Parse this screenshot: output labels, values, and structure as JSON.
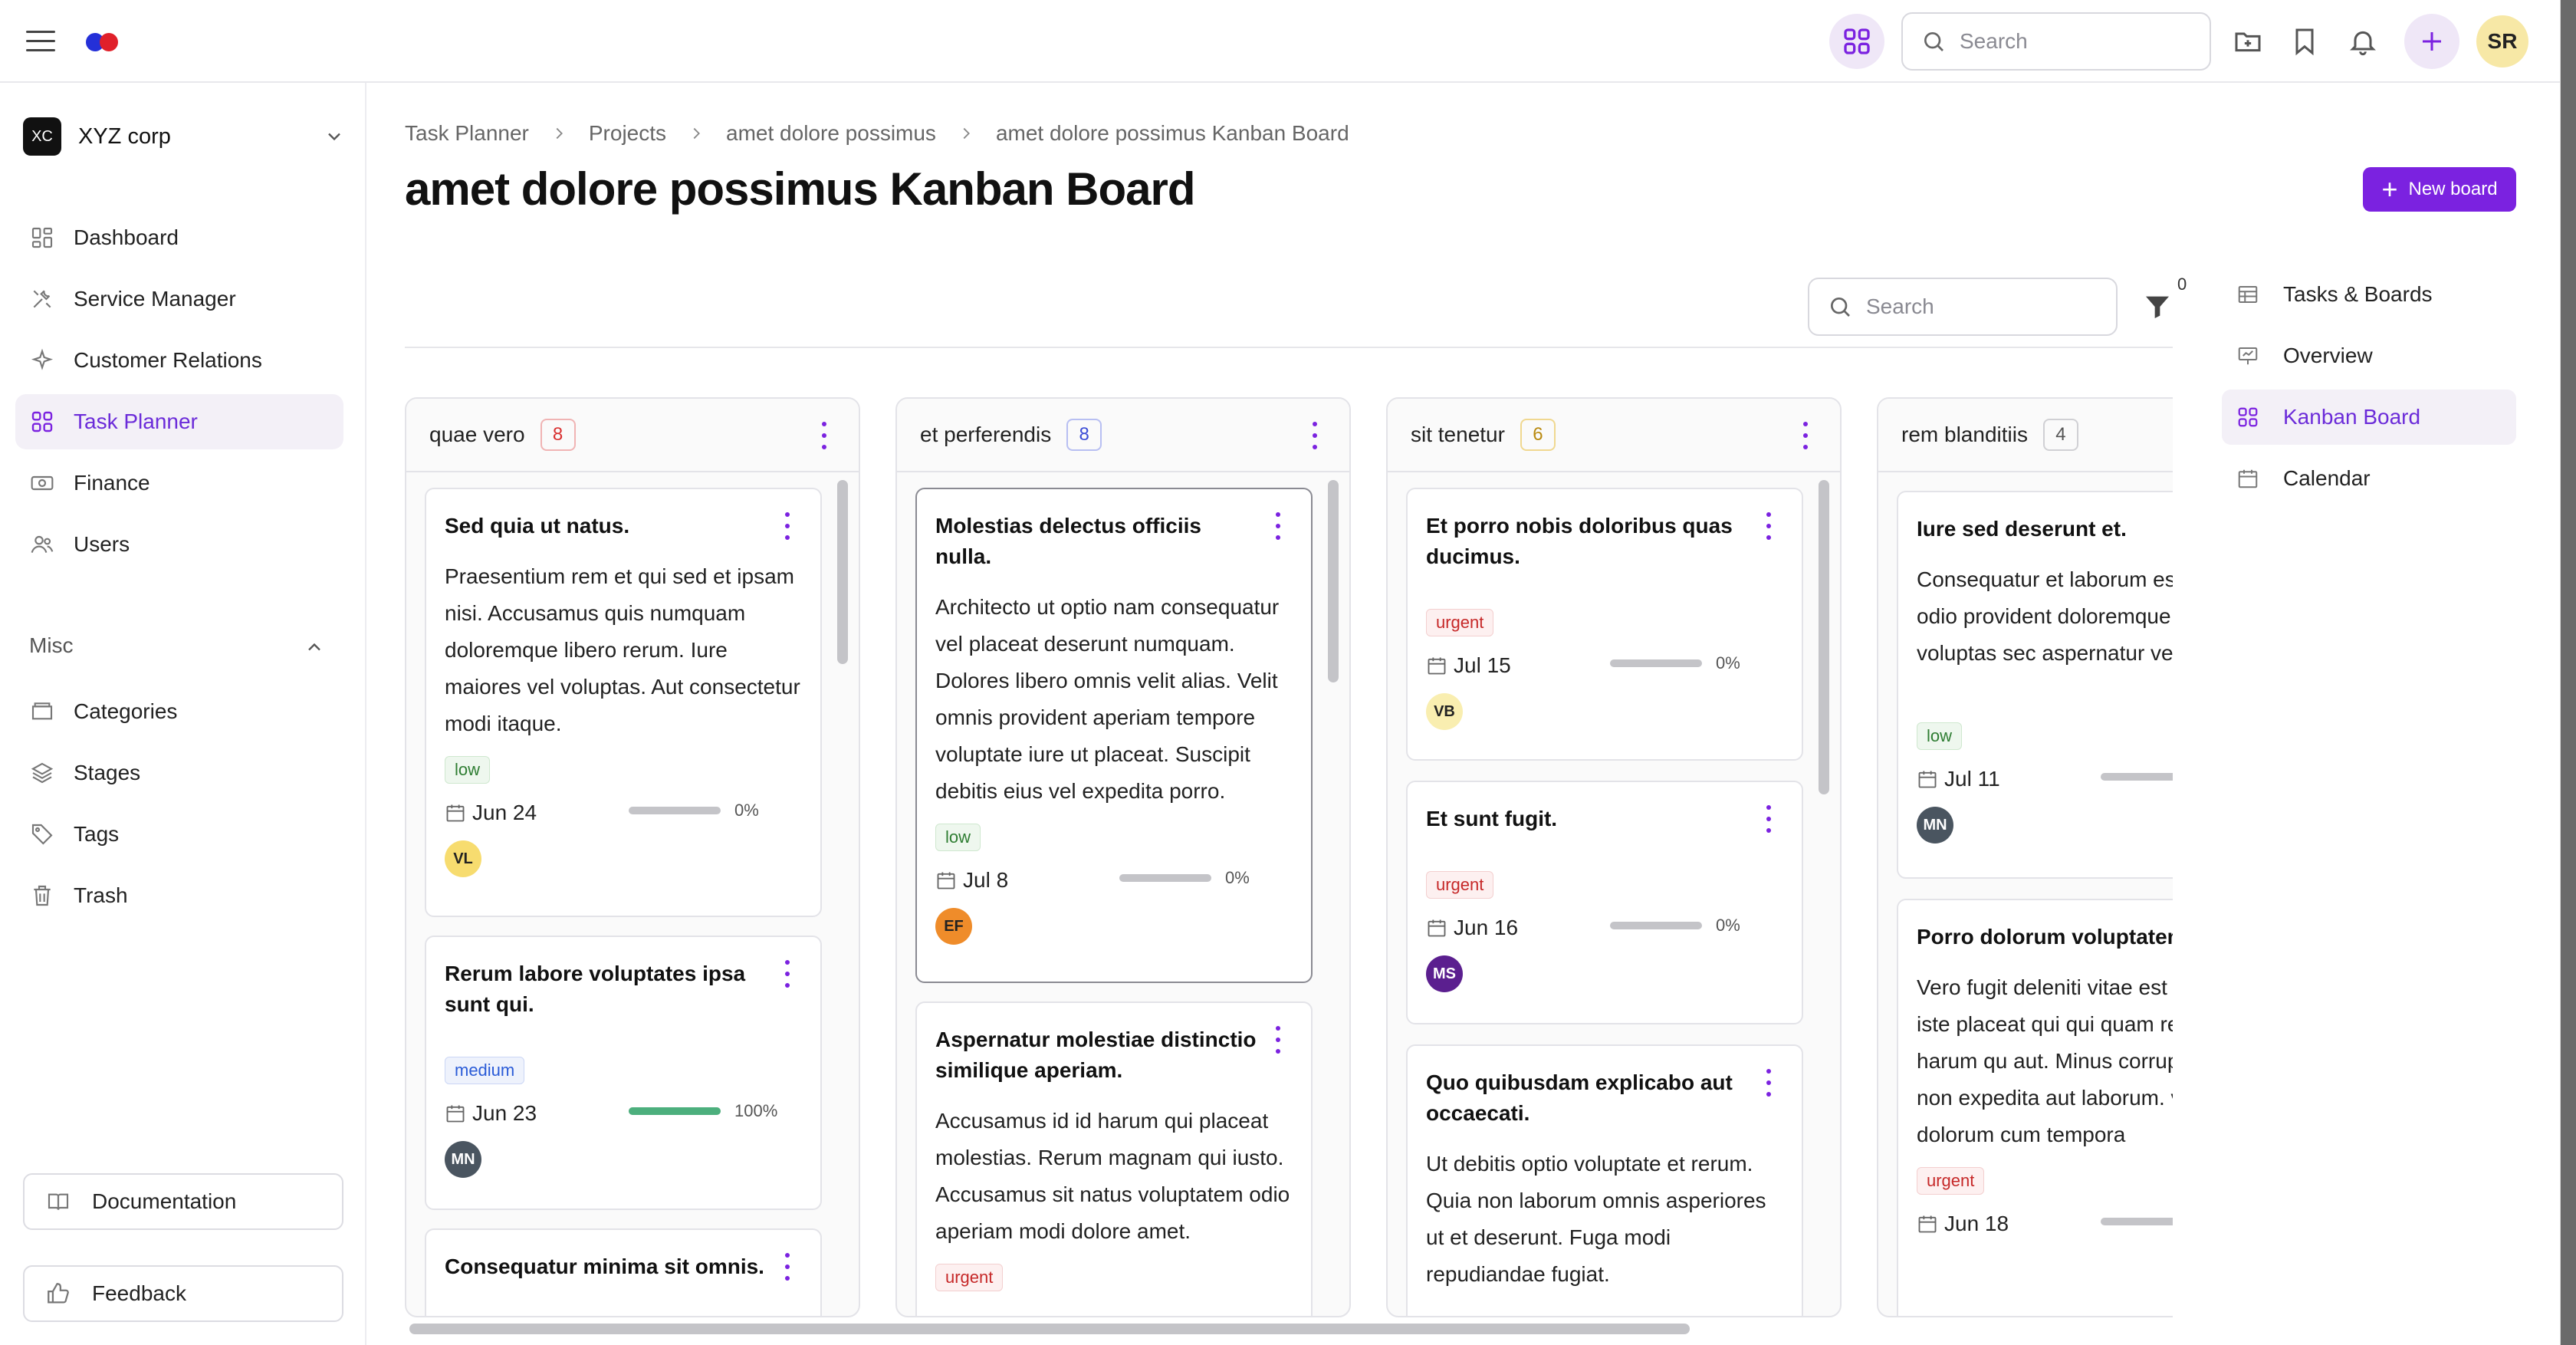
{
  "colors": {
    "accent": "#7b22e0",
    "dot_red": "#e0202a",
    "dot_blue": "#2430d8"
  },
  "topbar": {
    "search_placeholder": "Search",
    "user_initials": "SR"
  },
  "sidebar": {
    "org_badge": "XC",
    "org_name": "XYZ corp",
    "items": [
      {
        "label": "Dashboard",
        "icon": "dashboard-icon"
      },
      {
        "label": "Service Manager",
        "icon": "tools-icon"
      },
      {
        "label": "Customer Relations",
        "icon": "sparkle-icon"
      },
      {
        "label": "Task Planner",
        "icon": "grid-icon",
        "active": true
      },
      {
        "label": "Finance",
        "icon": "money-icon"
      },
      {
        "label": "Users",
        "icon": "users-icon"
      }
    ],
    "misc_label": "Misc",
    "misc_items": [
      {
        "label": "Categories",
        "icon": "folder-icon"
      },
      {
        "label": "Stages",
        "icon": "layers-icon"
      },
      {
        "label": "Tags",
        "icon": "tag-icon"
      },
      {
        "label": "Trash",
        "icon": "trash-icon"
      }
    ],
    "documentation": "Documentation",
    "feedback": "Feedback"
  },
  "breadcrumb": [
    "Task Planner",
    "Projects",
    "amet dolore possimus",
    "amet dolore possimus Kanban Board"
  ],
  "page_title": "amet dolore possimus Kanban Board",
  "new_board_label": "New board",
  "board_search_placeholder": "Search",
  "filter_count": "0",
  "right_panel": [
    {
      "label": "Tasks & Boards",
      "icon": "table-icon"
    },
    {
      "label": "Overview",
      "icon": "presentation-icon"
    },
    {
      "label": "Kanban Board",
      "icon": "grid-icon",
      "active": true
    },
    {
      "label": "Calendar",
      "icon": "calendar-icon"
    }
  ],
  "columns": [
    {
      "title": "quae vero",
      "count": "8",
      "count_color": "#d93030",
      "cards": [
        {
          "title": "Sed quia ut natus.",
          "desc": "Praesentium rem et qui sed et ipsam nisi. Accusamus quis numquam doloremque libero rerum. Iure maiores vel voluptas. Aut consectetur modi itaque.",
          "tag": "low",
          "date": "Jun 24",
          "progress": "0%",
          "progress_value": 0,
          "avatar": "VL",
          "avatar_bg": "#f7dc6f",
          "avatar_fg": "#222"
        },
        {
          "title": "Rerum labore voluptates ipsa sunt qui.",
          "desc": "",
          "tag": "medium",
          "date": "Jun 23",
          "progress": "100%",
          "progress_value": 100,
          "avatar": "MN",
          "avatar_bg": "#4a5560",
          "avatar_fg": "#fff"
        },
        {
          "title": "Consequatur minima sit omnis.",
          "desc": ""
        }
      ]
    },
    {
      "title": "et perferendis",
      "count": "8",
      "count_color": "#3b4cd6",
      "cards": [
        {
          "title": "Molestias delectus officiis nulla.",
          "desc": "Architecto ut optio nam consequatur vel placeat deserunt numquam. Dolores libero omnis velit alias. Velit omnis provident aperiam tempore voluptate iure ut placeat. Suscipit debitis eius vel expedita porro.",
          "tag": "low",
          "date": "Jul 8",
          "progress": "0%",
          "progress_value": 0,
          "avatar": "EF",
          "avatar_bg": "#ef8c2a",
          "avatar_fg": "#222"
        },
        {
          "title": "Aspernatur molestiae distinctio similique aperiam.",
          "desc": "Accusamus id id harum qui placeat molestias. Rerum magnam qui iusto. Accusamus sit natus voluptatem odio aperiam modi dolore amet.",
          "tag": "urgent"
        }
      ]
    },
    {
      "title": "sit tenetur",
      "count": "6",
      "count_color": "#d6a520",
      "cards": [
        {
          "title": "Et porro nobis doloribus quas ducimus.",
          "desc": "",
          "tag": "urgent",
          "date": "Jul 15",
          "progress": "0%",
          "progress_value": 0,
          "avatar": "VB",
          "avatar_bg": "#f9eeb0",
          "avatar_fg": "#222"
        },
        {
          "title": "Et sunt fugit.",
          "desc": "",
          "tag": "urgent",
          "date": "Jun 16",
          "progress": "0%",
          "progress_value": 0,
          "avatar": "MS",
          "avatar_bg": "#5b1f8f",
          "avatar_fg": "#fff"
        },
        {
          "title": "Quo quibusdam explicabo aut occaecati.",
          "desc": "Ut debitis optio voluptate et rerum. Quia non laborum omnis asperiores ut et deserunt. Fuga modi repudiandae fugiat."
        }
      ]
    },
    {
      "title": "rem blanditiis",
      "count": "4",
      "count_color": "#888888",
      "cards": [
        {
          "title": "Iure sed deserunt et.",
          "desc": "Consequatur et laborum es Molestiae odio provident doloremque. In voluptas sec aspernatur vel dicta aut.",
          "tag": "low",
          "date": "Jul 11",
          "progress": "",
          "progress_value": 0,
          "avatar": "MN",
          "avatar_bg": "#4a5560",
          "avatar_fg": "#fff"
        },
        {
          "title": "Porro dolorum voluptatem non.",
          "desc": "Vero fugit deleniti vitae est dolor ex iste placeat qui qui quam rerum et et harum qu aut. Minus corrupti quisqua non expedita aut laborum. vero dolorum cum tempora",
          "tag": "urgent",
          "date": "Jun 18"
        }
      ]
    }
  ]
}
